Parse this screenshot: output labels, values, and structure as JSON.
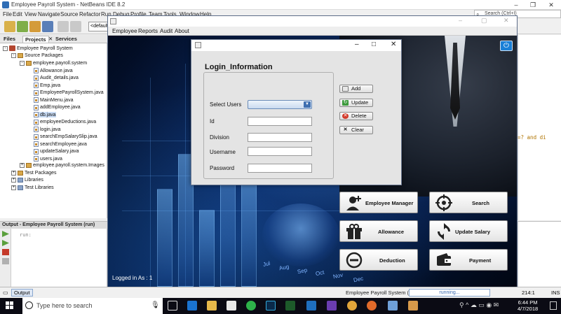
{
  "ide": {
    "title": "Employee Payroll System - NetBeans IDE 8.2",
    "menu": [
      "File",
      "Edit",
      "View",
      "Navigate",
      "Source",
      "Refactor",
      "Run",
      "Debug",
      "Profile",
      "Team",
      "Tools",
      "Window",
      "Help"
    ],
    "search_placeholder": "Search (Ctrl+I)",
    "config_value": "<default c",
    "panel_tabs": [
      "Files",
      "Projects",
      "Services"
    ],
    "tree": {
      "project": "Employee Payroll System",
      "source_packages": "Source Packages",
      "package": "employee.payroll.system",
      "files": [
        "Allowance.java",
        "Audit_details.java",
        "Emp.java",
        "EmployeePayrollSystem.java",
        "MainMenu.java",
        "addEmployee.java",
        "db.java",
        "employeeDeductions.java",
        "login.java",
        "searchEmpSalarySlip.java",
        "searchEmployee.java",
        "updateSalary.java",
        "users.java"
      ],
      "images_package": "employee.payroll.system.Images",
      "test_packages": "Test Packages",
      "libraries": "Libraries",
      "test_libraries": "Test Libraries"
    },
    "output_title": "Output - Employee Payroll System (run)",
    "output_text": "run:",
    "editor_code_fragment": "=? and di",
    "status": {
      "output_tab": "Output",
      "project": "Employee Payroll System (run)",
      "progress": "running...",
      "position": "214:1",
      "mode": "INS"
    }
  },
  "app": {
    "menu": [
      "Employee",
      "Reports",
      "Audit",
      "About"
    ],
    "logged_in": "Logged in As : 1",
    "months": [
      "Jul",
      "Aug",
      "Sep",
      "Oct",
      "Nov",
      "Dec"
    ],
    "buttons": {
      "employee_manager": "Employee Manager",
      "search": "Search",
      "allowance": "Allowance",
      "update_salary": "Update Salary",
      "deduction": "Deduction",
      "payment": "Payment"
    }
  },
  "dialog": {
    "heading": "Login_Information",
    "labels": {
      "select_users": "Select Users",
      "id": "Id",
      "division": "Division",
      "username": "Username",
      "password": "Password"
    },
    "actions": {
      "add": "Add",
      "update": "Update",
      "delete": "Delete",
      "clear": "Clear"
    }
  },
  "taskbar": {
    "search_placeholder": "Type here to search",
    "time": "6:44 PM",
    "date": "4/7/2018"
  }
}
